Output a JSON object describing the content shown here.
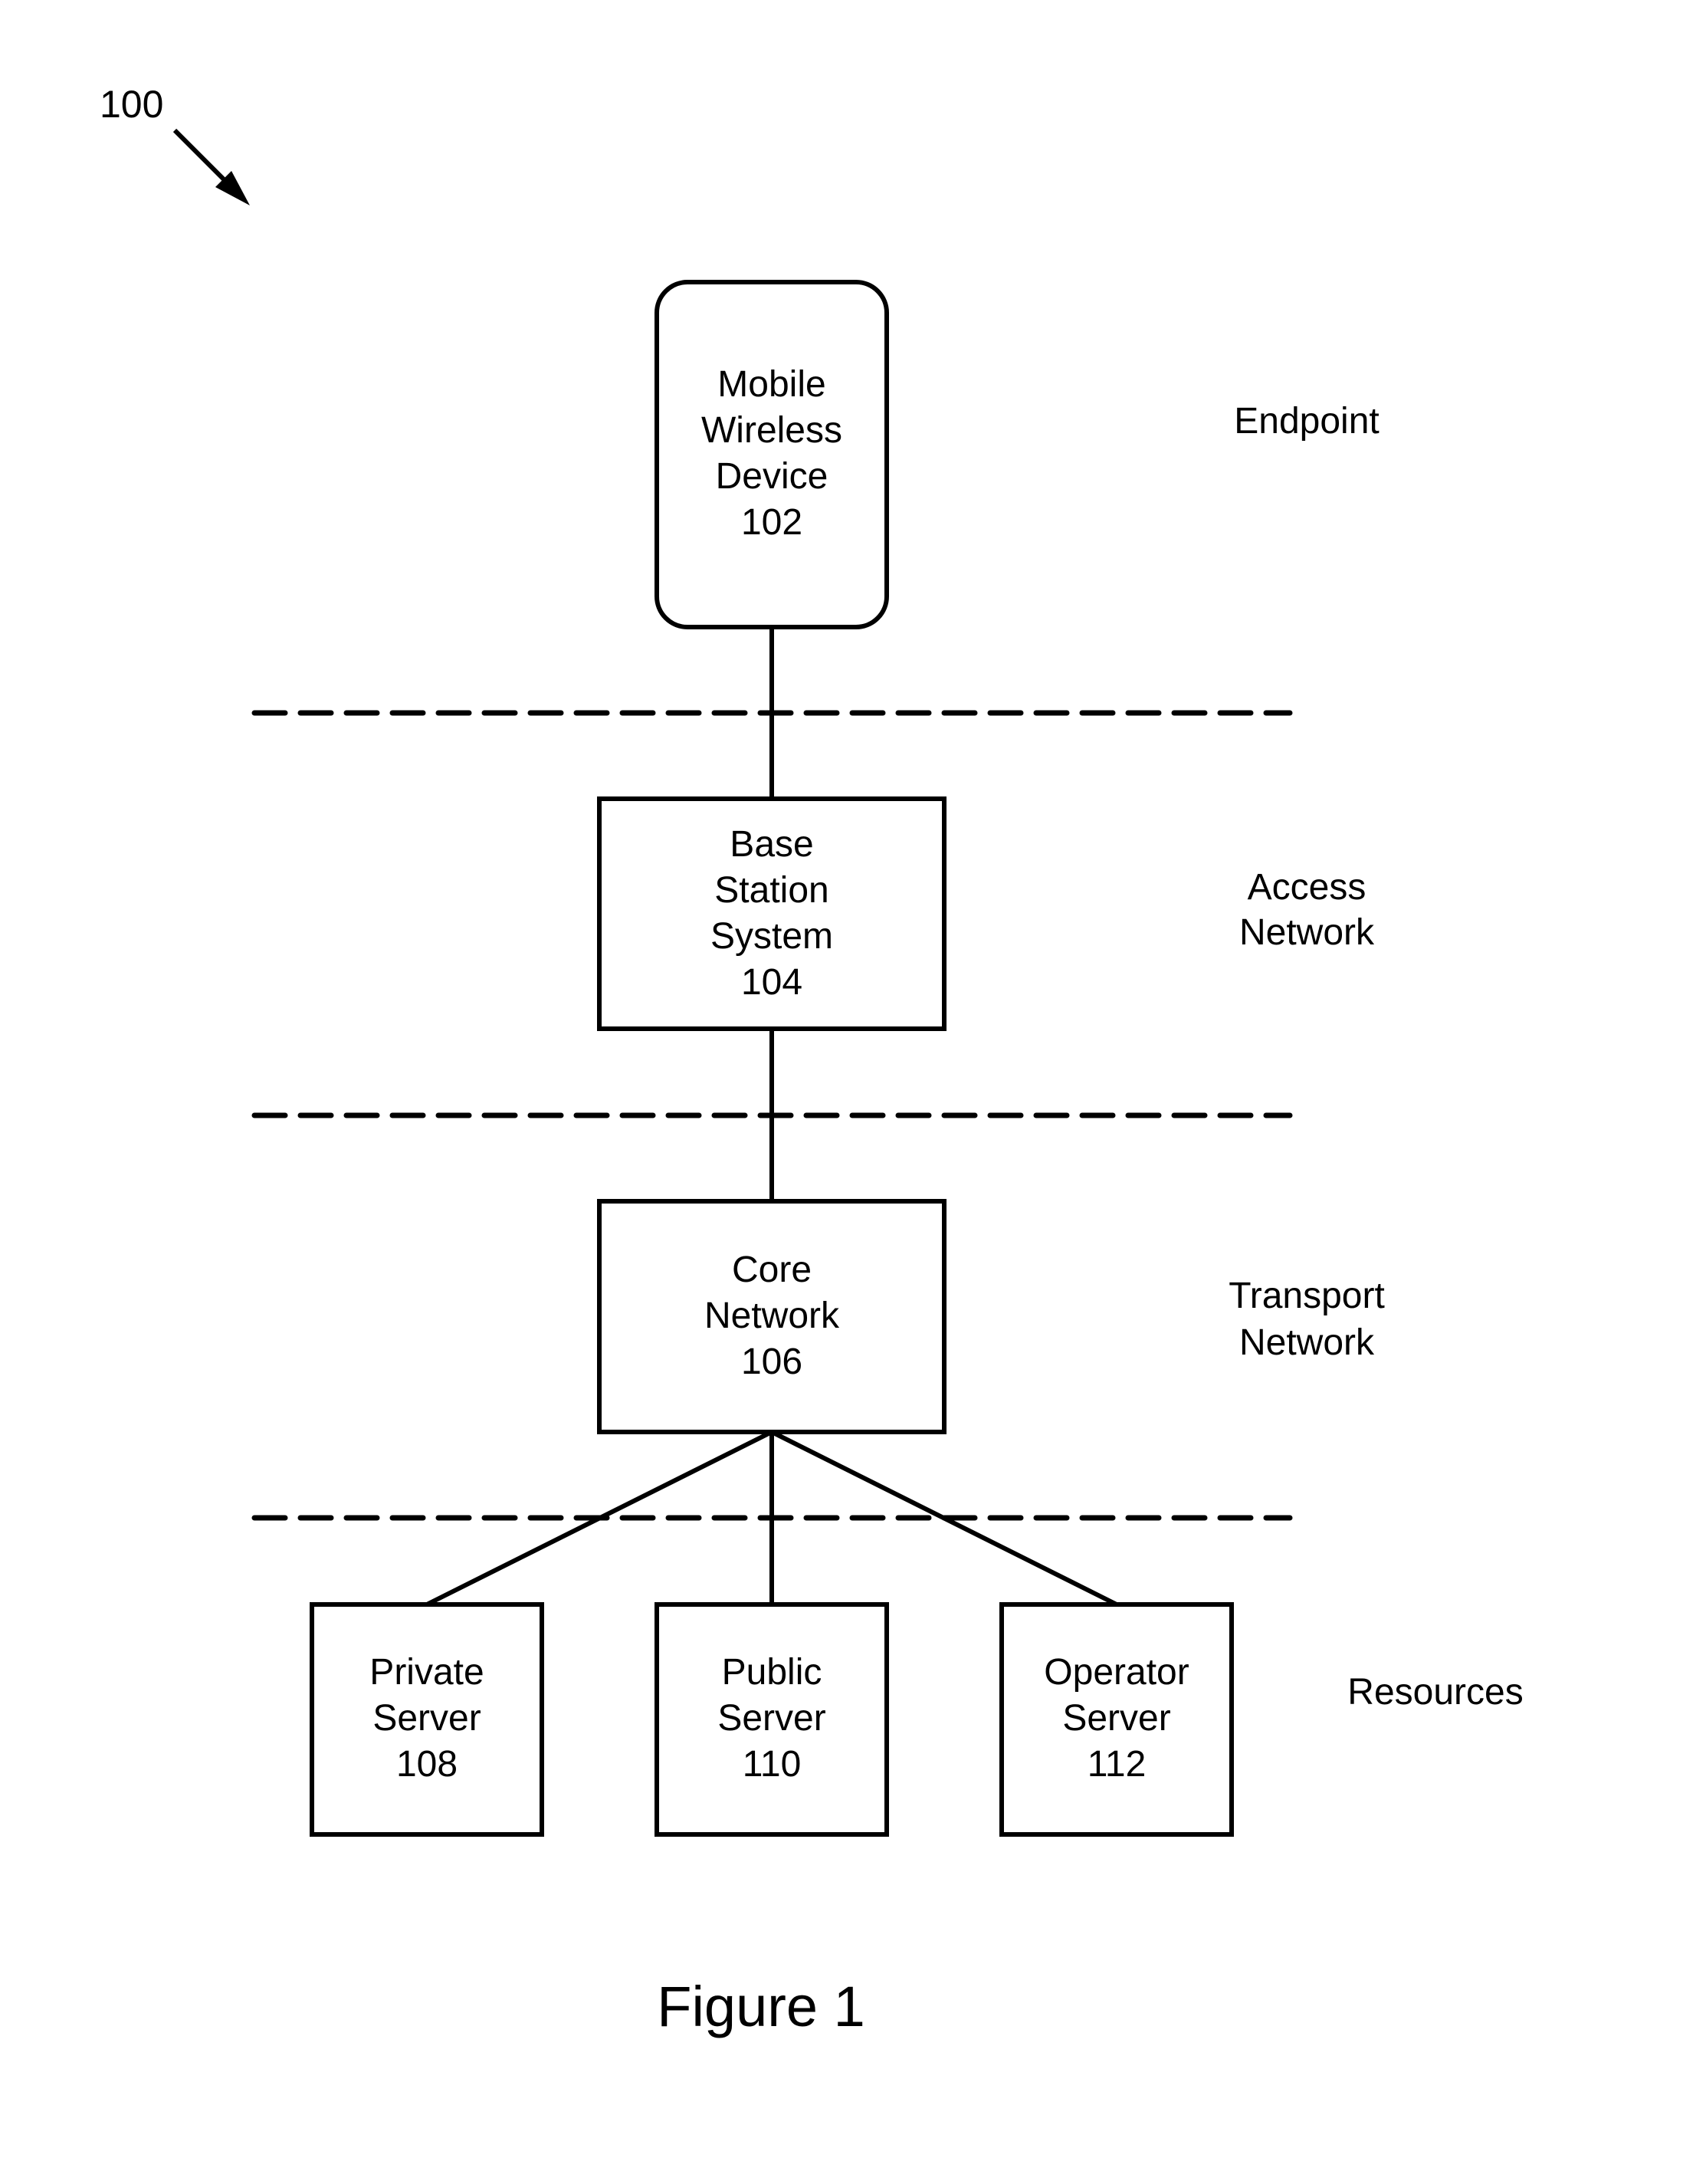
{
  "figure": {
    "reference_label": "100",
    "caption": "Figure 1"
  },
  "nodes": {
    "mobile": {
      "lines": [
        "Mobile",
        "Wireless",
        "Device",
        "102"
      ]
    },
    "base_station": {
      "lines": [
        "Base",
        "Station",
        "System",
        "104"
      ]
    },
    "core": {
      "lines": [
        "Core",
        "Network",
        "106"
      ]
    },
    "private_server": {
      "lines": [
        "Private",
        "Server",
        "108"
      ]
    },
    "public_server": {
      "lines": [
        "Public",
        "Server",
        "110"
      ]
    },
    "operator_server": {
      "lines": [
        "Operator",
        "Server",
        "112"
      ]
    }
  },
  "layers": {
    "endpoint": {
      "lines": [
        "Endpoint"
      ]
    },
    "access": {
      "lines": [
        "Access",
        "Network"
      ]
    },
    "transport": {
      "lines": [
        "Transport",
        "Network"
      ]
    },
    "resources": {
      "lines": [
        "Resources"
      ]
    }
  },
  "connections": [
    [
      "mobile",
      "base_station"
    ],
    [
      "base_station",
      "core"
    ],
    [
      "core",
      "private_server"
    ],
    [
      "core",
      "public_server"
    ],
    [
      "core",
      "operator_server"
    ]
  ],
  "colors": {
    "stroke": "#000000",
    "background": "#ffffff"
  }
}
